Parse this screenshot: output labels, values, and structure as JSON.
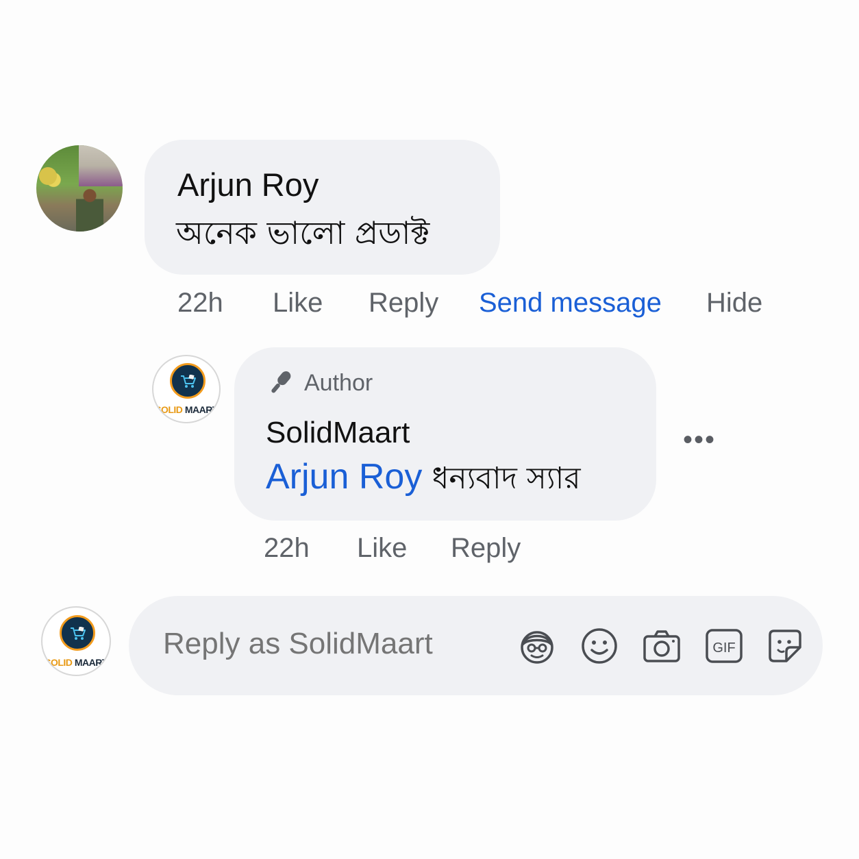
{
  "comment": {
    "author": "Arjun Roy",
    "text": "অনেক ভালো প্রডাক্ট",
    "actions": {
      "time": "22h",
      "like": "Like",
      "reply": "Reply",
      "send_message": "Send message",
      "hide": "Hide"
    }
  },
  "reply": {
    "badge": "Author",
    "author": "SolidMaart",
    "mention": "Arjun Roy",
    "text": "ধন্যবাদ স্যার",
    "more": "•••",
    "actions": {
      "time": "22h",
      "like": "Like",
      "reply": "Reply"
    }
  },
  "logo": {
    "part1": "SOLID",
    "part2": "MAART"
  },
  "composer": {
    "placeholder": "Reply as SolidMaart",
    "icons": [
      "avatar-sticker-icon",
      "emoji-icon",
      "camera-icon",
      "gif-icon",
      "sticker-icon"
    ],
    "gif_label": "GIF"
  },
  "colors": {
    "link": "#1a5fd6",
    "bubble": "#f0f1f4",
    "muted": "#5f6369"
  }
}
